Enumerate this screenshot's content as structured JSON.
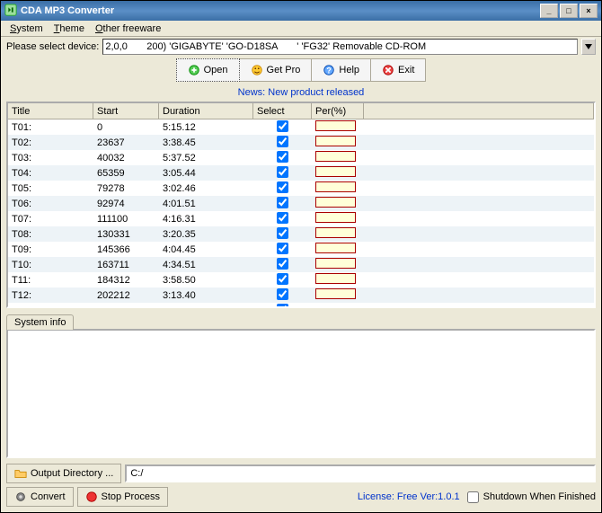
{
  "window": {
    "title": "CDA MP3 Converter"
  },
  "menu": {
    "system": "System",
    "theme": "Theme",
    "other": "Other freeware"
  },
  "device": {
    "label": "Please select device:",
    "value": "2,0,0       200) 'GIGABYTE' 'GO-D18SA       ' 'FG32' Removable CD-ROM"
  },
  "toolbar": {
    "open": "Open",
    "getpro": "Get Pro",
    "help": "Help",
    "exit": "Exit"
  },
  "news": {
    "prefix": "News: ",
    "link": "New product released"
  },
  "columns": {
    "title": "Title",
    "start": "Start",
    "duration": "Duration",
    "select": "Select",
    "per": "Per(%)"
  },
  "tracks": [
    {
      "title": "T01:",
      "start": "0",
      "duration": "5:15.12"
    },
    {
      "title": "T02:",
      "start": "23637",
      "duration": "3:38.45"
    },
    {
      "title": "T03:",
      "start": "40032",
      "duration": "5:37.52"
    },
    {
      "title": "T04:",
      "start": "65359",
      "duration": "3:05.44"
    },
    {
      "title": "T05:",
      "start": "79278",
      "duration": "3:02.46"
    },
    {
      "title": "T06:",
      "start": "92974",
      "duration": "4:01.51"
    },
    {
      "title": "T07:",
      "start": "111100",
      "duration": "4:16.31"
    },
    {
      "title": "T08:",
      "start": "130331",
      "duration": "3:20.35"
    },
    {
      "title": "T09:",
      "start": "145366",
      "duration": "4:04.45"
    },
    {
      "title": "T10:",
      "start": "163711",
      "duration": "4:34.51"
    },
    {
      "title": "T11:",
      "start": "184312",
      "duration": "3:58.50"
    },
    {
      "title": "T12:",
      "start": "202212",
      "duration": "3:13.40"
    }
  ],
  "systeminfo": {
    "tab": "System info"
  },
  "output": {
    "button": "Output Directory ...",
    "path": "C:/"
  },
  "actions": {
    "convert": "Convert",
    "stop": "Stop Process"
  },
  "footer": {
    "license": "License: Free Ver:1.0.1",
    "shutdown": "Shutdown When Finished"
  }
}
